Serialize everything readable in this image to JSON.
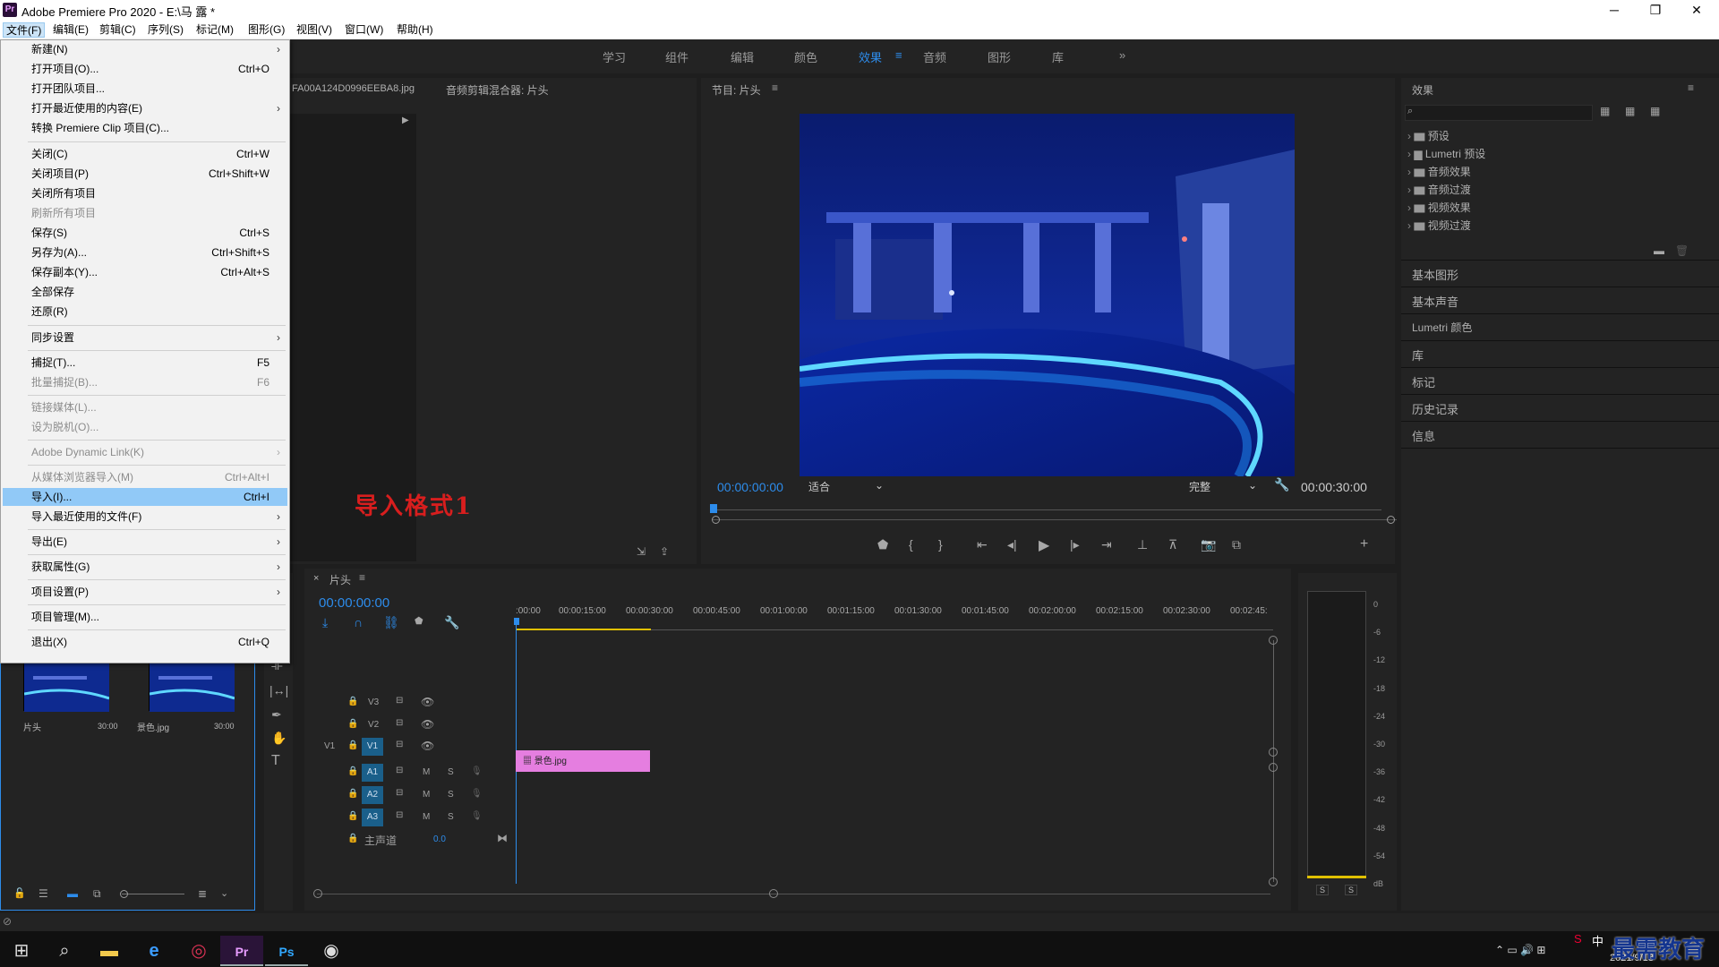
{
  "window": {
    "title": "Adobe Premiere Pro 2020 - E:\\马 露 *",
    "app_icon": "Pr",
    "min": "─",
    "max": "❐",
    "close": "✕"
  },
  "menubar": [
    "文件(F)",
    "编辑(E)",
    "剪辑(C)",
    "序列(S)",
    "标记(M)",
    "图形(G)",
    "视图(V)",
    "窗口(W)",
    "帮助(H)"
  ],
  "workspaces": [
    "学习",
    "组件",
    "编辑",
    "颜色",
    "效果",
    "音频",
    "图形",
    "库",
    "»"
  ],
  "file_menu": [
    {
      "label": "新建(N)",
      "shortcut": "",
      "sub": true,
      "dis": false
    },
    {
      "label": "打开项目(O)...",
      "shortcut": "Ctrl+O",
      "sub": false,
      "dis": false
    },
    {
      "label": "打开团队项目...",
      "shortcut": "",
      "sub": false,
      "dis": false
    },
    {
      "label": "打开最近使用的内容(E)",
      "shortcut": "",
      "sub": true,
      "dis": false
    },
    {
      "label": "转换 Premiere Clip 项目(C)...",
      "shortcut": "",
      "sub": false,
      "dis": false
    },
    {
      "label": "关闭(C)",
      "shortcut": "Ctrl+W",
      "sub": false,
      "dis": false
    },
    {
      "label": "关闭项目(P)",
      "shortcut": "Ctrl+Shift+W",
      "sub": false,
      "dis": false
    },
    {
      "label": "关闭所有项目",
      "shortcut": "",
      "sub": false,
      "dis": false
    },
    {
      "label": "刷新所有项目",
      "shortcut": "",
      "sub": false,
      "dis": true
    },
    {
      "label": "保存(S)",
      "shortcut": "Ctrl+S",
      "sub": false,
      "dis": false
    },
    {
      "label": "另存为(A)...",
      "shortcut": "Ctrl+Shift+S",
      "sub": false,
      "dis": false
    },
    {
      "label": "保存副本(Y)...",
      "shortcut": "Ctrl+Alt+S",
      "sub": false,
      "dis": false
    },
    {
      "label": "全部保存",
      "shortcut": "",
      "sub": false,
      "dis": false
    },
    {
      "label": "还原(R)",
      "shortcut": "",
      "sub": false,
      "dis": false
    },
    {
      "label": "同步设置",
      "shortcut": "",
      "sub": true,
      "dis": false
    },
    {
      "label": "捕捉(T)...",
      "shortcut": "F5",
      "sub": false,
      "dis": false
    },
    {
      "label": "批量捕捉(B)...",
      "shortcut": "F6",
      "sub": false,
      "dis": true
    },
    {
      "label": "链接媒体(L)...",
      "shortcut": "",
      "sub": false,
      "dis": true
    },
    {
      "label": "设为脱机(O)...",
      "shortcut": "",
      "sub": false,
      "dis": true
    },
    {
      "label": "Adobe Dynamic Link(K)",
      "shortcut": "",
      "sub": true,
      "dis": true
    },
    {
      "label": "从媒体浏览器导入(M)",
      "shortcut": "Ctrl+Alt+I",
      "sub": false,
      "dis": true
    },
    {
      "label": "导入(I)...",
      "shortcut": "Ctrl+I",
      "sub": false,
      "dis": false
    },
    {
      "label": "导入最近使用的文件(F)",
      "shortcut": "",
      "sub": true,
      "dis": false
    },
    {
      "label": "导出(E)",
      "shortcut": "",
      "sub": true,
      "dis": false
    },
    {
      "label": "获取属性(G)",
      "shortcut": "",
      "sub": true,
      "dis": false
    },
    {
      "label": "项目设置(P)",
      "shortcut": "",
      "sub": true,
      "dis": false
    },
    {
      "label": "项目管理(M)...",
      "shortcut": "",
      "sub": false,
      "dis": false
    },
    {
      "label": "退出(X)",
      "shortcut": "Ctrl+Q",
      "sub": false,
      "dis": false
    }
  ],
  "annotation": "导入格式1",
  "source_panel": {
    "file_tab": "FA00A124D0996EEBA8.jpg",
    "mixer_title": "音频剪辑混合器: 片头"
  },
  "program": {
    "title": "节目: 片头",
    "timecode": "00:00:00:00",
    "fit": "适合",
    "quality": "完整",
    "duration": "00:00:30:00"
  },
  "effects": {
    "title": "效果",
    "items": [
      "预设",
      "Lumetri 预设",
      "音频效果",
      "音频过渡",
      "视频效果",
      "视频过渡"
    ]
  },
  "side_panels": [
    "基本图形",
    "基本声音",
    "Lumetri 颜色",
    "库",
    "标记",
    "历史记录",
    "信息"
  ],
  "timeline": {
    "tab": "片头",
    "timecode": "00:00:00:00",
    "ruler": [
      ":00:00",
      "00:00:15:00",
      "00:00:30:00",
      "00:00:45:00",
      "00:01:00:00",
      "00:01:15:00",
      "00:01:30:00",
      "00:01:45:00",
      "00:02:00:00",
      "00:02:15:00",
      "00:02:30:00",
      "00:02:45:"
    ],
    "tracks": [
      "V3",
      "V2",
      "V1",
      "A1",
      "A2",
      "A3"
    ],
    "master": "主声道",
    "master_val": "0.0",
    "clip": "景色.jpg",
    "src_v1": "V1",
    "m": "M",
    "s": "S"
  },
  "project_items": [
    {
      "name": "片头",
      "dur": "30:00"
    },
    {
      "name": "景色.jpg",
      "dur": "30:00"
    }
  ],
  "meter": {
    "scale": [
      "0",
      "-6",
      "-12",
      "-18",
      "-24",
      "-30",
      "-36",
      "-42",
      "-48",
      "-54",
      "dB"
    ],
    "solo": [
      "S",
      "S"
    ]
  },
  "taskbar": {
    "date": "2021/9/13",
    "watermark": "最需教育",
    "ime": "中"
  }
}
